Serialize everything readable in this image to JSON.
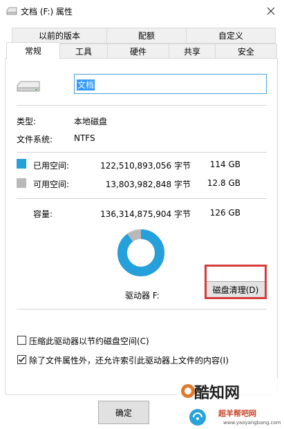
{
  "window": {
    "title": "文档 (F:) 属性",
    "close_glyph": "✕"
  },
  "tabs": {
    "row1": [
      "以前的版本",
      "配额",
      "自定义"
    ],
    "row2": [
      "常规",
      "工具",
      "硬件",
      "共享",
      "安全"
    ],
    "active": "常规"
  },
  "general": {
    "drive_name": "文档",
    "type_label": "类型:",
    "type_value": "本地磁盘",
    "fs_label": "文件系统:",
    "fs_value": "NTFS",
    "used_label": "已用空间:",
    "used_bytes": "122,510,893,056 字节",
    "used_size": "114 GB",
    "free_label": "可用空间:",
    "free_bytes": "13,803,982,848 字节",
    "free_size": "12.8 GB",
    "capacity_label": "容量:",
    "capacity_bytes": "136,314,875,904 字节",
    "capacity_size": "126 GB",
    "drive_label": "驱动器 F:",
    "cleanup_button": "磁盘清理(D)",
    "compress_label": "压缩此驱动器以节约磁盘空间(C)",
    "compress_checked": false,
    "index_label": "除了文件属性外，还允许索引此驱动器上文件的内容(I)",
    "index_checked": true
  },
  "usage": {
    "used_fraction": 0.8987,
    "used_color": "#26a0da",
    "free_color": "#b9b9b9"
  },
  "footer": {
    "ok_label": "确定"
  },
  "watermark": {
    "title": "酷知网",
    "subtitle": "超羊帮吧网",
    "url": "www.yaoyangbang.com"
  }
}
